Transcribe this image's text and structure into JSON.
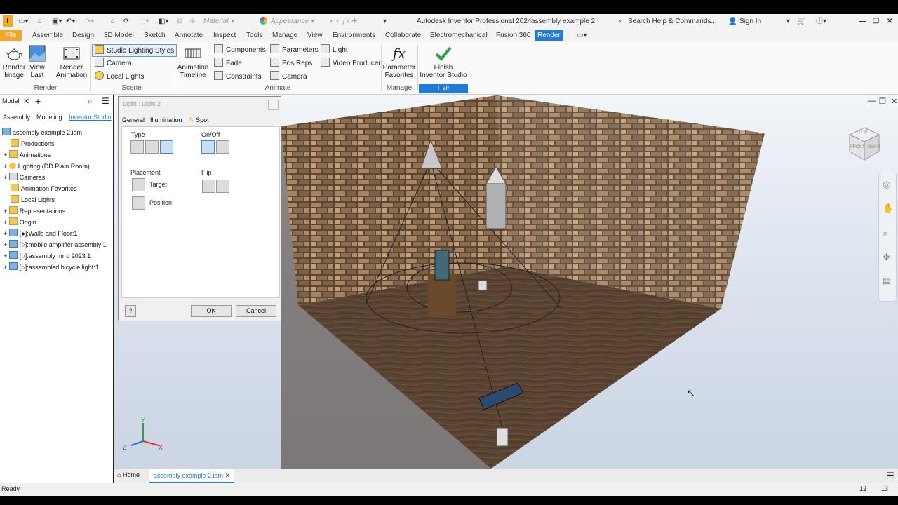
{
  "app": {
    "logo_letter": "I",
    "title": "Autodesk Inventor Professional 2024",
    "document_name": "assembly example 2",
    "material": "Material",
    "appearance": "Appearance",
    "search": "Search Help & Commands...",
    "sign_in": "Sign In"
  },
  "tabs": [
    "File",
    "Assemble",
    "Design",
    "3D Model",
    "Sketch",
    "Annotate",
    "Inspect",
    "Tools",
    "Manage",
    "View",
    "Environments",
    "Collaborate",
    "Electromechanical",
    "Fusion 360",
    "Render"
  ],
  "ribbon": {
    "render_image": "Render\nImage",
    "view_last": "View\nLast",
    "render_animation": "Render\nAnimation",
    "render_group": "Render",
    "studio_lighting_styles": "Studio Lighting Styles",
    "camera": "Camera",
    "local_lights": "Local Lights",
    "scene_group": "Scene",
    "animation_timeline": "Animation\nTimeline",
    "components": "Components",
    "fade": "Fade",
    "constraints": "Constraints",
    "parameters": "Parameters",
    "pos_reps": "Pos Reps",
    "camera2": "Camera",
    "light": "Light",
    "video_producer": "Video Producer",
    "animate_group": "Animate",
    "parameter_favorites": "Parameter\nFavorites",
    "manage_group": "Manage",
    "finish_inventor_studio": "Finish\nInventor Studio",
    "exit_group": "Exit"
  },
  "browser": {
    "model_tab": "Model",
    "sub_tabs": [
      "Assembly",
      "Modeling",
      "Inventor Studio"
    ],
    "items": [
      {
        "label": "assembly example 2.iam",
        "icon": "assembly-icon"
      },
      {
        "label": "Productions",
        "icon": "folder-icon"
      },
      {
        "label": "Animations",
        "icon": "folder-icon"
      },
      {
        "label": "Lighting (DD Plain Room)",
        "icon": "light-icon"
      },
      {
        "label": "Cameras",
        "icon": "camera-icon"
      },
      {
        "label": "Animation Favorites",
        "icon": "folder-icon"
      },
      {
        "label": "Local Lights",
        "icon": "folder-icon"
      },
      {
        "label": "Representations",
        "icon": "folder-icon"
      },
      {
        "label": "Origin",
        "icon": "folder-icon"
      },
      {
        "label": "[●]:Walls and Floor:1",
        "icon": "assembly-icon"
      },
      {
        "label": "[○]:mobile amplifier assembly:1",
        "icon": "assembly-icon"
      },
      {
        "label": "[○]:assembly mr d 2023:1",
        "icon": "assembly-icon"
      },
      {
        "label": "[○]:assembled bicycle light:1",
        "icon": "assembly-icon"
      }
    ]
  },
  "dialog": {
    "title": "Light : Light 2",
    "tabs": [
      "General",
      "Illumination",
      "Spot"
    ],
    "type_label": "Type",
    "onoff_label": "On/Off",
    "placement_label": "Placement",
    "target_label": "Target",
    "position_label": "Position",
    "flip_label": "Flip",
    "ok": "OK",
    "cancel": "Cancel",
    "help": "?"
  },
  "viewcube": {
    "top": "TOP",
    "front": "FRONT",
    "right": "RIGHT"
  },
  "axes": {
    "x": "X",
    "y": "Y",
    "z": "Z"
  },
  "doc_tabs": {
    "home": "Home",
    "active": "assembly example 2.iam"
  },
  "status": {
    "text": "Ready",
    "count1": "12",
    "count2": "13"
  },
  "colors": {
    "accent": "#1f7bd8",
    "file_tab": "#f5a623",
    "finish_check": "#2ea043"
  }
}
